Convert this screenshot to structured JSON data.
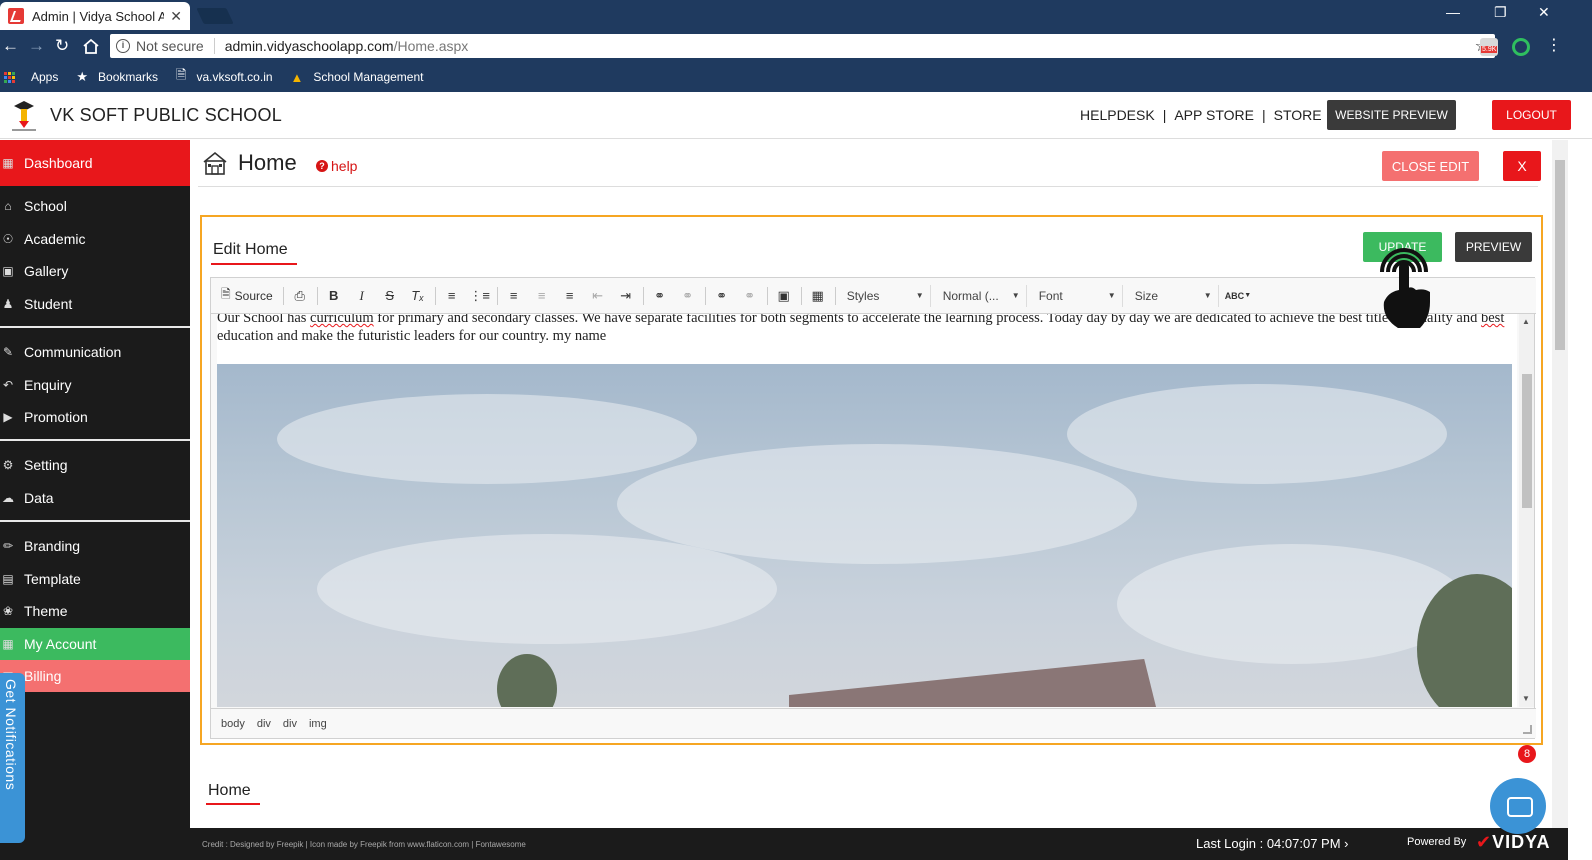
{
  "browser": {
    "tab_title": "Admin | Vidya School Ap",
    "tab_close": "✕",
    "not_secure": "Not secure",
    "url_host": "admin.vidyaschoolapp.com",
    "url_path": "/Home.aspx",
    "window_controls": [
      "—",
      "❐",
      "✕"
    ],
    "extension_badge": "5.9K"
  },
  "bookmarks": {
    "items": [
      {
        "label": "Apps",
        "icon": "apps-grid-icon"
      },
      {
        "label": "Bookmarks",
        "icon": "star-icon"
      },
      {
        "label": "va.vksoft.co.in",
        "icon": "page-icon"
      },
      {
        "label": "School Management",
        "icon": "school-favicon-icon"
      }
    ]
  },
  "header": {
    "school_name": "VK SOFT PUBLIC SCHOOL",
    "links": [
      "HELPDESK",
      "APP STORE",
      "STORE"
    ],
    "link_separator": "|",
    "website_preview": "WEBSITE PREVIEW",
    "logout": "LOGOUT"
  },
  "sidebar": {
    "items": [
      {
        "label": "Dashboard",
        "icon": "grid-icon",
        "state": "active"
      },
      {
        "label": "School",
        "icon": "school-icon"
      },
      {
        "label": "Academic",
        "icon": "globe-icon"
      },
      {
        "label": "Gallery",
        "icon": "image-icon"
      },
      {
        "label": "Student",
        "icon": "student-icon"
      },
      {
        "label": "Communication",
        "icon": "megaphone-icon"
      },
      {
        "label": "Enquiry",
        "icon": "reply-icon"
      },
      {
        "label": "Promotion",
        "icon": "bullhorn-icon"
      },
      {
        "label": "Setting",
        "icon": "gear-icon"
      },
      {
        "label": "Data",
        "icon": "cloud-icon"
      },
      {
        "label": "Branding",
        "icon": "brush-icon"
      },
      {
        "label": "Template",
        "icon": "template-icon"
      },
      {
        "label": "Theme",
        "icon": "palette-icon"
      },
      {
        "label": "My Account",
        "icon": "account-icon",
        "state": "green"
      },
      {
        "label": "Billing",
        "icon": "billing-icon",
        "state": "pink"
      }
    ],
    "notifications_tab": "Get Notifications"
  },
  "page": {
    "title": "Home",
    "help": "help",
    "close_edit": "CLOSE EDIT",
    "close_x": "X",
    "edit_title": "Edit Home",
    "update": "UPDATE",
    "preview": "PREVIEW",
    "section_title": "Home"
  },
  "editor": {
    "toolbar": {
      "source": "Source",
      "styles": "Styles",
      "format": "Normal (...",
      "font": "Font",
      "size": "Size",
      "spell": "ABC"
    },
    "content_line1": "Our School has ",
    "content_curriculum": "curriculum",
    "content_line1b": " for primary and secondary classes. We have separate facilities for both segments to accelerate the learning process. Today day by day we are dedicated to achieve the best title for quality and ",
    "content_best": "best",
    "content_line2": " education and make the futuristic leaders for our country. my name",
    "path": [
      "body",
      "div",
      "div",
      "img"
    ],
    "badge_count": "8"
  },
  "footer": {
    "credit": "Credit : Designed by Freepik | Icon made by Freepik from www.flaticon.com | Fontawesome",
    "last_login": "Last Login : 04:07:07 PM",
    "powered_by": "Powered By",
    "brand": "VIDYA"
  },
  "colors": {
    "browser_chrome": "#1f3a5f",
    "primary_red": "#e8171b",
    "green": "#3cba5f",
    "pink": "#f47070",
    "dark": "#1b1b1b",
    "panel_border": "#f6a623",
    "notif_blue": "#3b93d6"
  }
}
